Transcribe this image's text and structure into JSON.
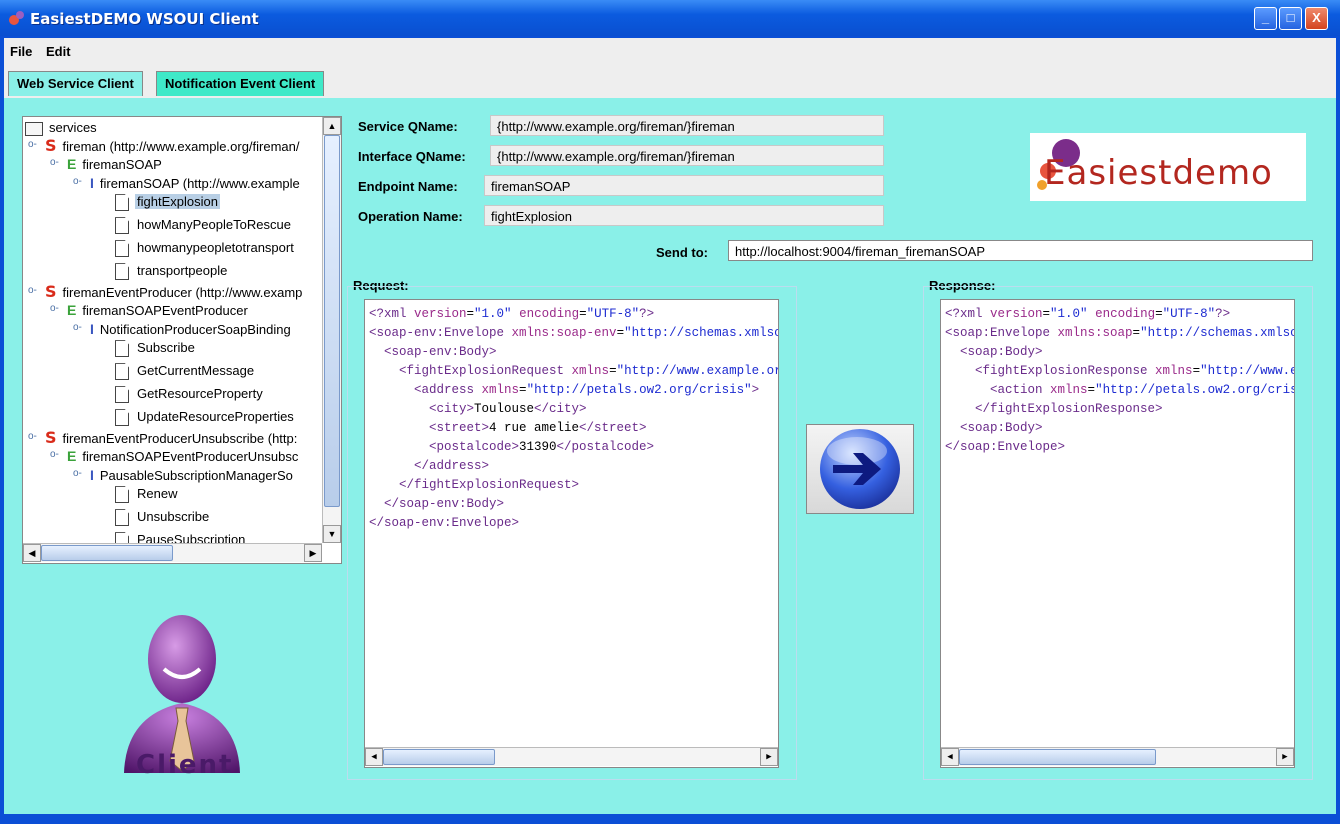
{
  "window": {
    "title": "EasiestDEMO WSOUI Client",
    "min_label": "_",
    "max_label": "□",
    "close_label": "X"
  },
  "menu": [
    "File",
    "Edit"
  ],
  "tabs": [
    "Web Service Client",
    "Notification Event Client"
  ],
  "tree": {
    "root": "services",
    "s1": "fireman (http://www.example.org/fireman/",
    "s1e": "firemanSOAP",
    "s1i": "firemanSOAP (http://www.example",
    "s1ops": [
      "fightExplosion",
      "howManyPeopleToRescue",
      "howmanypeopletotransport",
      "transportpeople"
    ],
    "s2": "firemanEventProducer (http://www.examp",
    "s2e": "firemanSOAPEventProducer",
    "s2i": "NotificationProducerSoapBinding",
    "s2ops": [
      "Subscribe",
      "GetCurrentMessage",
      "GetResourceProperty",
      "UpdateResourceProperties"
    ],
    "s3": "firemanEventProducerUnsubscribe (http:",
    "s3e": "firemanSOAPEventProducerUnsubsc",
    "s3i": "PausableSubscriptionManagerSo",
    "s3ops": [
      "Renew",
      "Unsubscribe",
      "PauseSubscription"
    ]
  },
  "form": {
    "service_label": "Service QName:",
    "service_value": "{http://www.example.org/fireman/}fireman",
    "interface_label": "Interface QName:",
    "interface_value": "{http://www.example.org/fireman/}fireman",
    "endpoint_label": "Endpoint Name:",
    "endpoint_value": "firemanSOAP",
    "operation_label": "Operation Name:",
    "operation_value": "fightExplosion",
    "sendto_label": "Send to:",
    "sendto_value": "http://localhost:9004/fireman_firemanSOAP"
  },
  "request_label": "Request:",
  "response_label": "Response:",
  "logo_text": "Easiestdemo",
  "client_label": "Client",
  "colors": {
    "background": "#8af0e8",
    "tag": "#6a2b8a",
    "attr": "#9a2a8a",
    "value": "#1d2bd1"
  }
}
